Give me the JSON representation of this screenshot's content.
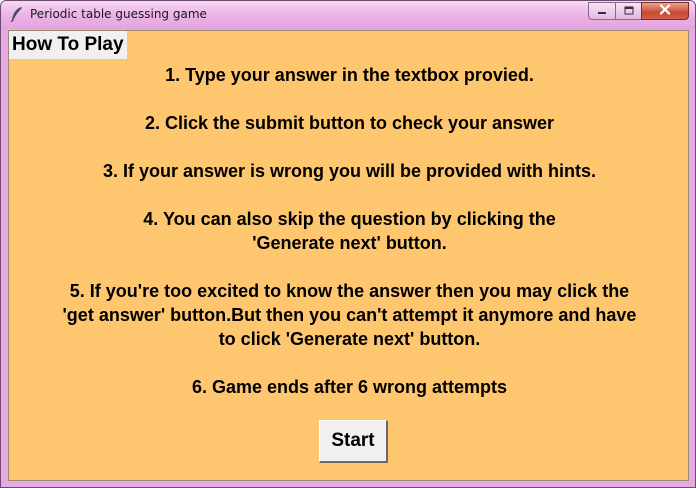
{
  "window": {
    "title": "Periodic table guessing game",
    "icons": {
      "app": "feather-icon",
      "minimize": "minimize-icon",
      "maximize": "maximize-icon",
      "close": "close-icon"
    },
    "colors": {
      "titlebar": "#e7a9e2",
      "background": "#fec66e",
      "close_button": "#c84a32"
    }
  },
  "content": {
    "heading": "How To Play",
    "rules": [
      "1. Type your answer in the textbox provied.",
      "2. Click the submit button to check your answer",
      "3. If your answer is wrong you will be provided with hints.",
      "4. You can also skip the question by clicking the\n'Generate next' button.",
      "5. If you're too excited to know the answer then you may click the\n'get answer' button.But then you can't attempt it anymore and have\nto click 'Generate next' button.",
      "6. Game ends after 6 wrong attempts"
    ],
    "start_label": "Start"
  }
}
